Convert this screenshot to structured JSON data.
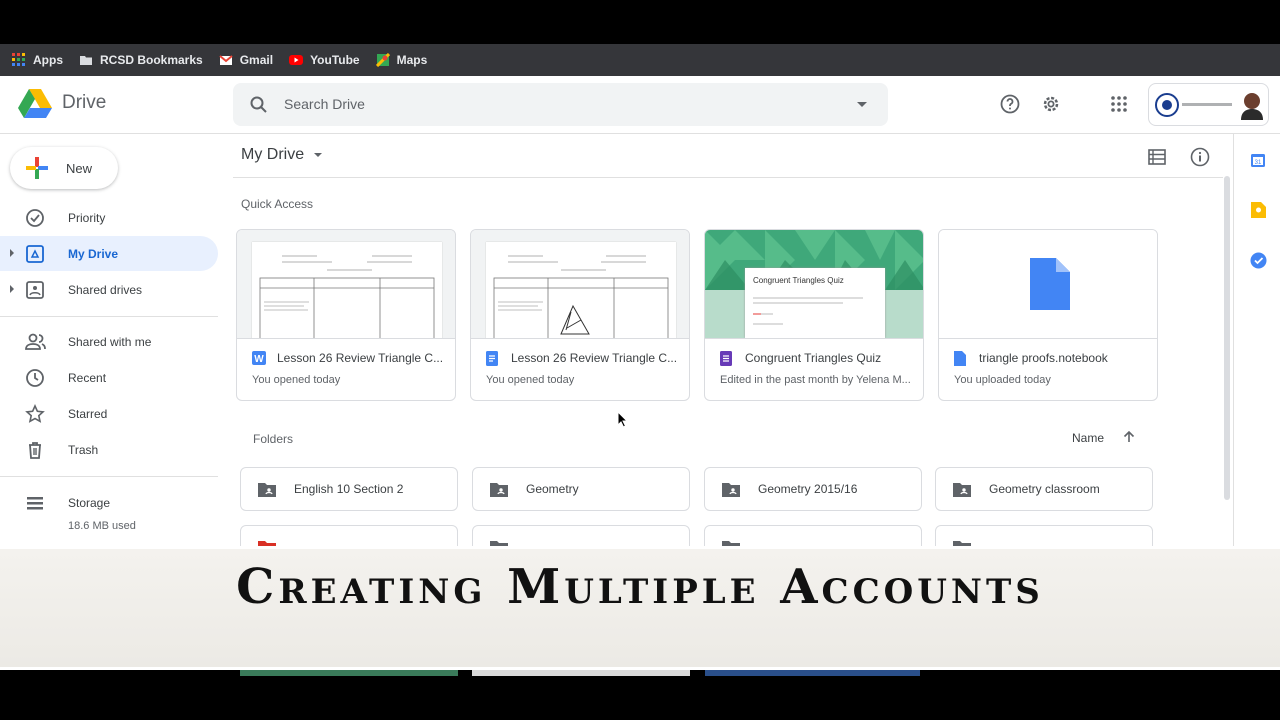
{
  "bookmarks": [
    {
      "label": "Apps",
      "icon": "apps-grid-icon"
    },
    {
      "label": "RCSD Bookmarks",
      "icon": "folder-icon"
    },
    {
      "label": "Gmail",
      "icon": "gmail-icon"
    },
    {
      "label": "YouTube",
      "icon": "youtube-icon"
    },
    {
      "label": "Maps",
      "icon": "maps-icon"
    }
  ],
  "header": {
    "logo_text": "Drive",
    "search_placeholder": "Search Drive"
  },
  "sidebar": {
    "new_label": "New",
    "items": [
      {
        "label": "Priority",
        "icon": "priority-check-icon"
      },
      {
        "label": "My Drive",
        "icon": "my-drive-icon",
        "active": true
      },
      {
        "label": "Shared drives",
        "icon": "shared-drives-icon"
      },
      {
        "label": "Shared with me",
        "icon": "shared-with-me-icon"
      },
      {
        "label": "Recent",
        "icon": "clock-icon"
      },
      {
        "label": "Starred",
        "icon": "star-icon"
      },
      {
        "label": "Trash",
        "icon": "trash-icon"
      }
    ],
    "storage": {
      "label": "Storage",
      "used": "18.6 MB used"
    }
  },
  "main": {
    "breadcrumb": "My Drive",
    "quick_access_title": "Quick Access",
    "quick_access": [
      {
        "title": "Lesson 26 Review Triangle C...",
        "subtitle": "You opened today",
        "type": "word"
      },
      {
        "title": "Lesson 26 Review Triangle C...",
        "subtitle": "You opened today",
        "type": "docs"
      },
      {
        "title": "Congruent Triangles Quiz",
        "subtitle": "Edited in the past month by Yelena M...",
        "type": "forms",
        "preview_title": "Congruent Triangles Quiz"
      },
      {
        "title": "triangle proofs.notebook",
        "subtitle": "You uploaded today",
        "type": "file"
      }
    ],
    "folders_title": "Folders",
    "sort_label": "Name",
    "folders": [
      {
        "name": "English 10 Section 2"
      },
      {
        "name": "Geometry"
      },
      {
        "name": "Geometry 2015/16"
      },
      {
        "name": "Geometry classroom"
      }
    ]
  },
  "banner": {
    "text": "Creating Multiple Accounts"
  },
  "colors": {
    "drive_blue": "#1967d2",
    "active_bg": "#e8f0fe",
    "forms_purple": "#673ab7",
    "docs_blue": "#4285f4"
  }
}
